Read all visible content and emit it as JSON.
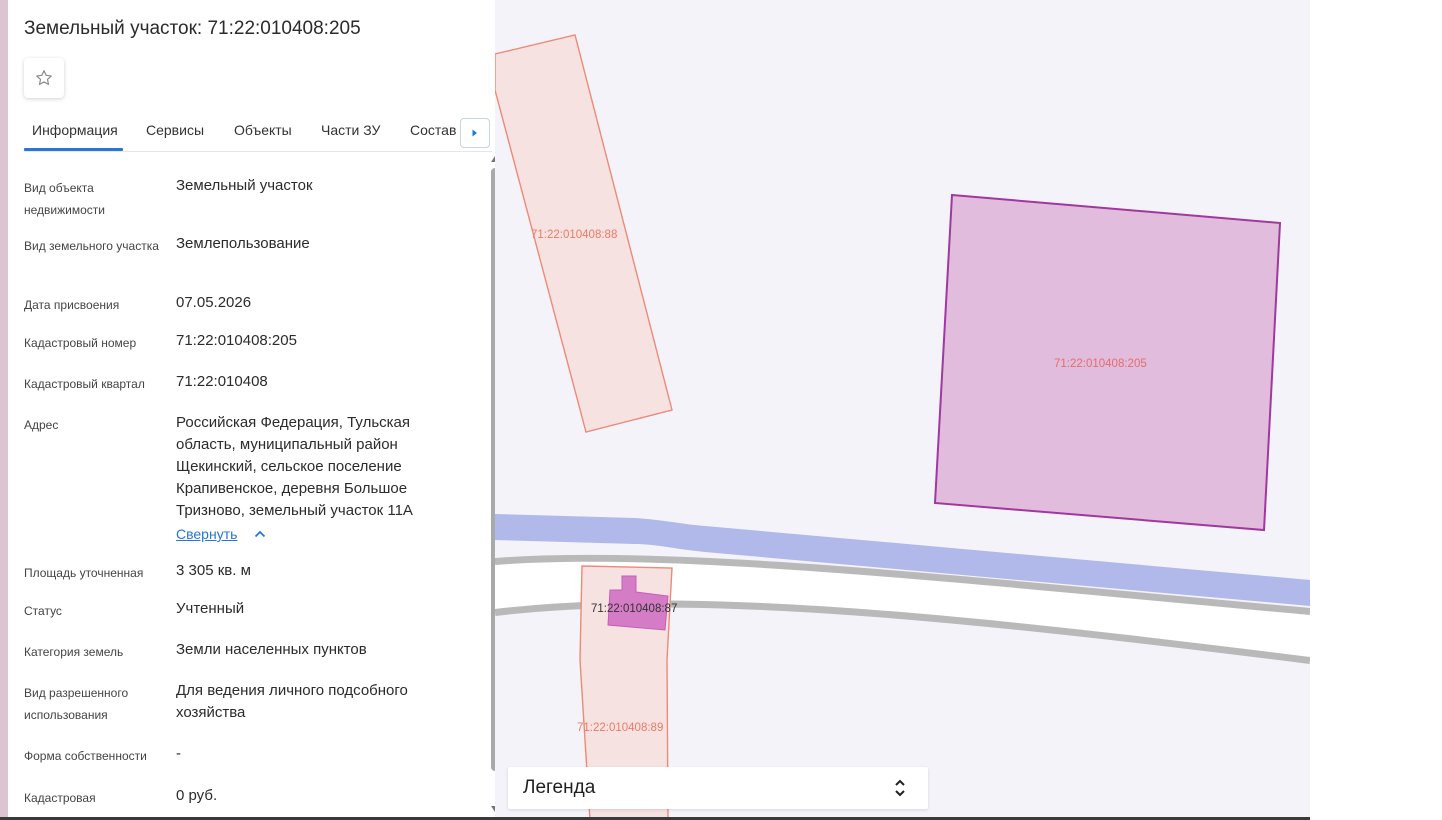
{
  "panel": {
    "title": "Земельный участок: 71:22:010408:205",
    "tabs": [
      "Информация",
      "Сервисы",
      "Объекты",
      "Части ЗУ",
      "Состав"
    ],
    "active_tab": "Информация",
    "fields": [
      {
        "label": "Вид объекта недвижимости",
        "value": "Земельный участок"
      },
      {
        "label": "Вид земельного участка",
        "value": "Землепользование"
      },
      {
        "label": "Дата присвоения",
        "value": "07.05.2026"
      },
      {
        "label": "Кадастровый номер",
        "value": "71:22:010408:205"
      },
      {
        "label": "Кадастровый квартал",
        "value": "71:22:010408"
      },
      {
        "label": "Адрес",
        "value": "Российская Федерация, Тульская область, муниципальный район Щекинский, сельское поселение Крапивенское, деревня Большое Тризново, земельный участок 11А"
      },
      {
        "label": "Площадь уточненная",
        "value": "3 305 кв. м"
      },
      {
        "label": "Статус",
        "value": "Учтенный"
      },
      {
        "label": "Категория земель",
        "value": "Земли населенных пунктов"
      },
      {
        "label": "Вид разрешенного использования",
        "value": "Для ведения личного подсобного хозяйства"
      },
      {
        "label": "Форма собственности",
        "value": "-"
      },
      {
        "label": "Кадастровая стоимость",
        "value": "0 руб."
      }
    ],
    "collapse_label": "Свернуть"
  },
  "map": {
    "parcels": [
      {
        "label": "71:22:010408:88"
      },
      {
        "label": "71:22:010408:205"
      },
      {
        "label": "71:22:010408:87"
      },
      {
        "label": "71:22:010408:89"
      }
    ],
    "legend_label": "Легенда"
  },
  "icons": {
    "favorite": "star-outline-icon",
    "tabs_next": "triangle-right-icon",
    "legend_toggle": "chevron-up-down-icon",
    "collapse": "chevron-up-icon"
  },
  "colors": {
    "accent": "#2577d8",
    "selected_parcel_fill": "#e2bcdc",
    "selected_parcel_stroke": "#a137a0",
    "parcel_fill": "#f7e2e2",
    "parcel_stroke": "#ee8a76",
    "water": "#b1b8ea",
    "map_background": "#f3f3f9"
  }
}
